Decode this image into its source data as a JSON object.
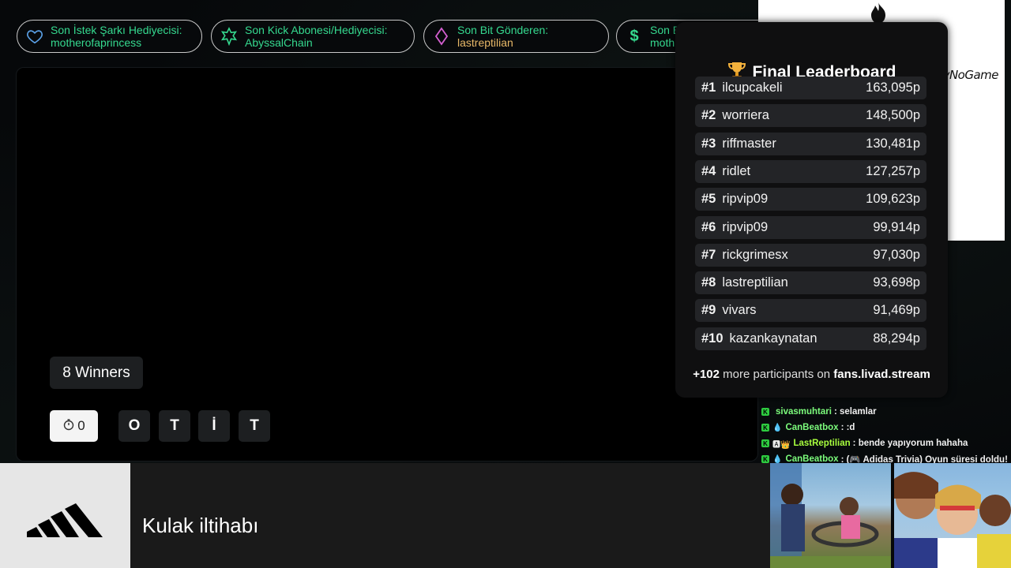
{
  "alerts": [
    {
      "label": "Son İstek Şarkı Hediyecisi:",
      "value": "motherofaprincess",
      "icon": "heart-icon"
    },
    {
      "label": "Son Kick Abonesi/Hediyecisi:",
      "value": "AbyssalChain",
      "icon": "star-icon"
    },
    {
      "label": "Son Bit Gönderen:",
      "value": "lastreptilian",
      "icon": "diamond-icon"
    },
    {
      "label": "Son B",
      "value": "moth",
      "icon": "dollar-icon"
    }
  ],
  "brand_text": "yNoGame",
  "game": {
    "winners": "8 Winners",
    "timer": "0",
    "letters": [
      "O",
      "T",
      "İ",
      "T"
    ]
  },
  "leaderboard": {
    "title": "Final Leaderboard",
    "rows": [
      {
        "rank": "#1",
        "name": "ilcupcakeli",
        "score": "163,095p"
      },
      {
        "rank": "#2",
        "name": "worriera",
        "score": "148,500p"
      },
      {
        "rank": "#3",
        "name": "riffmaster",
        "score": "130,481p"
      },
      {
        "rank": "#4",
        "name": "ridlet",
        "score": "127,257p"
      },
      {
        "rank": "#5",
        "name": "ripvip09",
        "score": "109,623p"
      },
      {
        "rank": "#6",
        "name": "ripvip09",
        "score": "99,914p"
      },
      {
        "rank": "#7",
        "name": "rickgrimesx",
        "score": "97,030p"
      },
      {
        "rank": "#8",
        "name": "lastreptilian",
        "score": "93,698p"
      },
      {
        "rank": "#9",
        "name": "vivars",
        "score": "91,469p"
      },
      {
        "rank": "#10",
        "name": "kazankaynatan",
        "score": "88,294p"
      }
    ],
    "footer_count": "+102",
    "footer_text": "more participants on",
    "footer_site": "fans.livad.stream"
  },
  "chat": [
    {
      "user": "sivasmuhtari",
      "color": "#7cfc7c",
      "message": ": selamlar",
      "badges": ""
    },
    {
      "user": "CanBeatbox",
      "color": "#7cfc7c",
      "message": ": :d",
      "badges": "💧"
    },
    {
      "user": "LastReptilian",
      "color": "#a8ff3e",
      "message": ": bende yapıyorum hahaha",
      "badges": "🅰👑"
    },
    {
      "user": "CanBeatbox",
      "color": "#7cfc7c",
      "message": ": (🎮 Adidas Trivia) Oyun süresi doldu!",
      "badges": "💧"
    }
  ],
  "bottom": {
    "question": "Kulak iltihabı",
    "logo": "adidas-logo"
  },
  "colors": {
    "alert_text": "#35d98f",
    "alert_gold": "#e8b868",
    "leaderboard_bg": "#0f0f10",
    "row_bg": "#232427"
  }
}
